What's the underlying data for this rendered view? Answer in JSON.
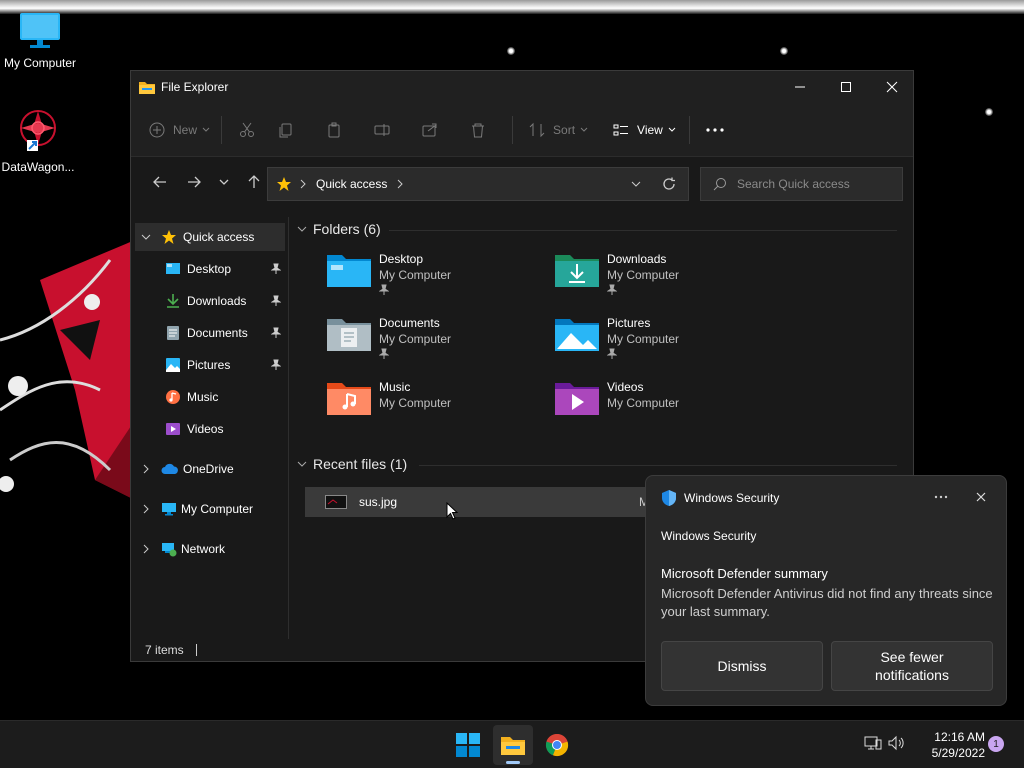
{
  "desktop": {
    "icons": [
      {
        "label": "My Computer"
      },
      {
        "label": "DataWagon..."
      }
    ]
  },
  "window": {
    "title": "File Explorer",
    "commands": {
      "new": "New",
      "sort": "Sort",
      "view": "View"
    },
    "address": {
      "location": "Quick access"
    },
    "search": {
      "placeholder": "Search Quick access"
    },
    "sidebar": {
      "quick_access": "Quick access",
      "items": [
        "Desktop",
        "Downloads",
        "Documents",
        "Pictures",
        "Music",
        "Videos"
      ],
      "onedrive": "OneDrive",
      "my_computer": "My Computer",
      "network": "Network"
    },
    "folders_header": "Folders (6)",
    "folders": [
      {
        "name": "Desktop",
        "location": "My Computer",
        "pinned": true
      },
      {
        "name": "Downloads",
        "location": "My Computer",
        "pinned": true
      },
      {
        "name": "Documents",
        "location": "My Computer",
        "pinned": true
      },
      {
        "name": "Pictures",
        "location": "My Computer",
        "pinned": true
      },
      {
        "name": "Music",
        "location": "My Computer",
        "pinned": false
      },
      {
        "name": "Videos",
        "location": "My Computer",
        "pinned": false
      }
    ],
    "recent_header": "Recent files (1)",
    "recent_files": [
      {
        "name": "sus.jpg",
        "location_fragment": "M"
      }
    ],
    "status": "7 items"
  },
  "toast": {
    "app": "Windows Security",
    "source": "Windows Security",
    "heading": "Microsoft Defender summary",
    "body": "Microsoft Defender Antivirus did not find any threats since your last summary.",
    "dismiss": "Dismiss",
    "fewer_line1": "See fewer",
    "fewer_line2": "notifications"
  },
  "taskbar": {
    "time": "12:16 AM",
    "date": "5/29/2022",
    "badge": "1"
  }
}
